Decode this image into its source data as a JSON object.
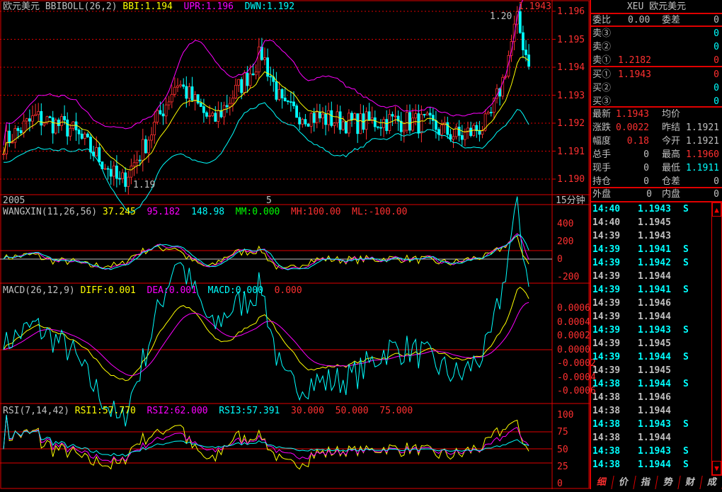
{
  "main": {
    "name": "欧元美元",
    "indicator": "BBIBOLL(26,2)",
    "bbi": "BBI:1.194",
    "upr": "UPR:1.196",
    "dwn": "DWN:1.192",
    "high_label": "1.20",
    "low_label": "1.19",
    "last_price_label": "1.1943",
    "yticks": [
      "1.196",
      "1.195",
      "1.194",
      "1.193",
      "1.192",
      "1.191",
      "1.190"
    ],
    "xlabels": [
      "2005",
      "5"
    ],
    "period": "15分钟"
  },
  "wangxin": {
    "name": "WANGXIN(11,26,56)",
    "v1": "37.245",
    "v2": "95.182",
    "v3": "148.98",
    "mm": "MM:0.000",
    "mh": "MH:100.00",
    "ml": "ML:-100.00",
    "yticks": [
      "400",
      "200",
      "0",
      "-200"
    ]
  },
  "macd": {
    "name": "MACD(26,12,9)",
    "diff": "DIFF:0.001",
    "dea": "DEA:0.001",
    "macd": "MACD:0.000",
    "extra": "0.000",
    "yticks": [
      "0.0006",
      "0.0004",
      "0.0002",
      "0.0000",
      "-0.0002",
      "-0.0004",
      "-0.0006"
    ]
  },
  "rsi": {
    "name": "RSI(7,14,42)",
    "rsi1": "RSI1:57.770",
    "rsi2": "RSI2:62.000",
    "rsi3": "RSI3:57.391",
    "l1": "30.000",
    "l2": "50.000",
    "l3": "75.000",
    "yticks": [
      "100",
      "75",
      "50",
      "25",
      "0"
    ]
  },
  "price_path": [
    [
      0,
      1.1912
    ],
    [
      50,
      1.1922
    ],
    [
      100,
      1.1918
    ],
    [
      150,
      1.1905
    ],
    [
      170,
      1.1898
    ],
    [
      200,
      1.191
    ],
    [
      250,
      1.1935
    ],
    [
      300,
      1.192
    ],
    [
      350,
      1.1937
    ],
    [
      370,
      1.1945
    ],
    [
      400,
      1.1925
    ],
    [
      450,
      1.1922
    ],
    [
      500,
      1.192
    ],
    [
      550,
      1.1921
    ],
    [
      600,
      1.192
    ],
    [
      650,
      1.1915
    ],
    [
      690,
      1.192
    ],
    [
      710,
      1.1935
    ],
    [
      730,
      1.1957
    ],
    [
      745,
      1.1943
    ]
  ],
  "quote": {
    "title": "XEU 欧元美元",
    "wb_label": "委比",
    "wb": "0.00",
    "wc_label": "委差",
    "wc": "0",
    "sells": [
      {
        "label": "卖③",
        "price": "",
        "vol": "0"
      },
      {
        "label": "卖②",
        "price": "",
        "vol": "0"
      },
      {
        "label": "卖①",
        "price": "1.2182",
        "vol": "0"
      }
    ],
    "buys": [
      {
        "label": "买①",
        "price": "1.1943",
        "vol": "0"
      },
      {
        "label": "买②",
        "price": "",
        "vol": "0"
      },
      {
        "label": "买③",
        "price": "",
        "vol": "0"
      }
    ],
    "stats": [
      {
        "l1": "最新",
        "v1": "1.1943",
        "l2": "均价",
        "v2": ""
      },
      {
        "l1": "涨跌",
        "v1": "0.0022",
        "l2": "昨结",
        "v2": "1.1921"
      },
      {
        "l1": "幅度",
        "v1": "0.18",
        "l2": "今开",
        "v2": "1.1921"
      },
      {
        "l1": "总手",
        "v1": "0",
        "l2": "最高",
        "v2": "1.1960"
      },
      {
        "l1": "现手",
        "v1": "0",
        "l2": "最低",
        "v2": "1.1911"
      },
      {
        "l1": "持仓",
        "v1": "0",
        "l2": "仓差",
        "v2": "0"
      }
    ],
    "outer_label": "外盘",
    "outer": "0",
    "inner_label": "内盘",
    "inner": "0"
  },
  "ticks": [
    [
      "14:40",
      "1.1943",
      "S"
    ],
    [
      "14:40",
      "1.1945",
      ""
    ],
    [
      "14:39",
      "1.1943",
      ""
    ],
    [
      "14:39",
      "1.1941",
      "S"
    ],
    [
      "14:39",
      "1.1942",
      "S"
    ],
    [
      "14:39",
      "1.1944",
      ""
    ],
    [
      "14:39",
      "1.1941",
      "S"
    ],
    [
      "14:39",
      "1.1946",
      ""
    ],
    [
      "14:39",
      "1.1944",
      ""
    ],
    [
      "14:39",
      "1.1943",
      "S"
    ],
    [
      "14:39",
      "1.1945",
      ""
    ],
    [
      "14:39",
      "1.1944",
      "S"
    ],
    [
      "14:39",
      "1.1945",
      ""
    ],
    [
      "14:38",
      "1.1944",
      "S"
    ],
    [
      "14:38",
      "1.1946",
      ""
    ],
    [
      "14:38",
      "1.1944",
      ""
    ],
    [
      "14:38",
      "1.1943",
      "S"
    ],
    [
      "14:38",
      "1.1944",
      ""
    ],
    [
      "14:38",
      "1.1943",
      "S"
    ],
    [
      "14:38",
      "1.1944",
      "S"
    ]
  ],
  "tabs": [
    "细",
    "价",
    "指",
    "势",
    "财",
    "成"
  ],
  "colors": {
    "red": "#ff3030",
    "cyan": "#00ffff",
    "yellow": "#ffff00",
    "magenta": "#ff00ff",
    "border": "#e00000"
  }
}
